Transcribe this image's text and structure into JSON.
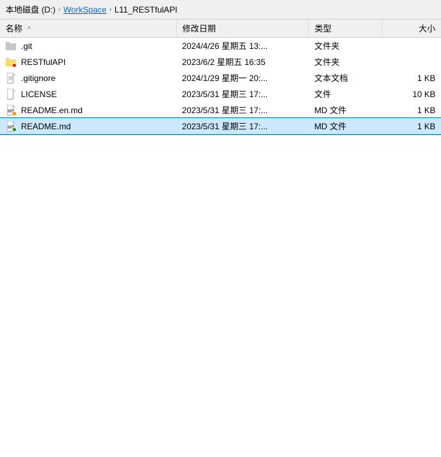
{
  "breadcrumb": {
    "items": [
      {
        "label": "本地磁盘 (D:)",
        "id": "local-disk"
      },
      {
        "label": "WorkSpace",
        "id": "workspace"
      },
      {
        "label": "L11_RESTfulAPI",
        "id": "l11-restful"
      }
    ],
    "separator": "›"
  },
  "sort": {
    "indicator": "^"
  },
  "columns": {
    "name": "名称",
    "date": "修改日期",
    "type": "类型",
    "size": "大小"
  },
  "files": [
    {
      "id": "git-folder",
      "name": ".git",
      "date": "2024/4/26 星期五 13:...",
      "type": "文件夹",
      "size": "",
      "icon": "folder-git",
      "selected": false
    },
    {
      "id": "restfulapi-folder",
      "name": "RESTfulAPI",
      "date": "2023/6/2 星期五 16:35",
      "type": "文件夹",
      "size": "",
      "icon": "folder-special",
      "selected": false
    },
    {
      "id": "gitignore-file",
      "name": ".gitignore",
      "date": "2024/1/29 星期一 20:...",
      "type": "文本文档",
      "size": "1 KB",
      "icon": "textfile",
      "selected": false
    },
    {
      "id": "license-file",
      "name": "LICENSE",
      "date": "2023/5/31 星期三 17:...",
      "type": "文件",
      "size": "10 KB",
      "icon": "file",
      "selected": false
    },
    {
      "id": "readme-en-file",
      "name": "README.en.md",
      "date": "2023/5/31 星期三 17:...",
      "type": "MD 文件",
      "size": "1 KB",
      "icon": "md-orange",
      "selected": false
    },
    {
      "id": "readme-md-file",
      "name": "README.md",
      "date": "2023/5/31 星期三 17:...",
      "type": "MD 文件",
      "size": "1 KB",
      "icon": "md-green",
      "selected": true
    }
  ]
}
